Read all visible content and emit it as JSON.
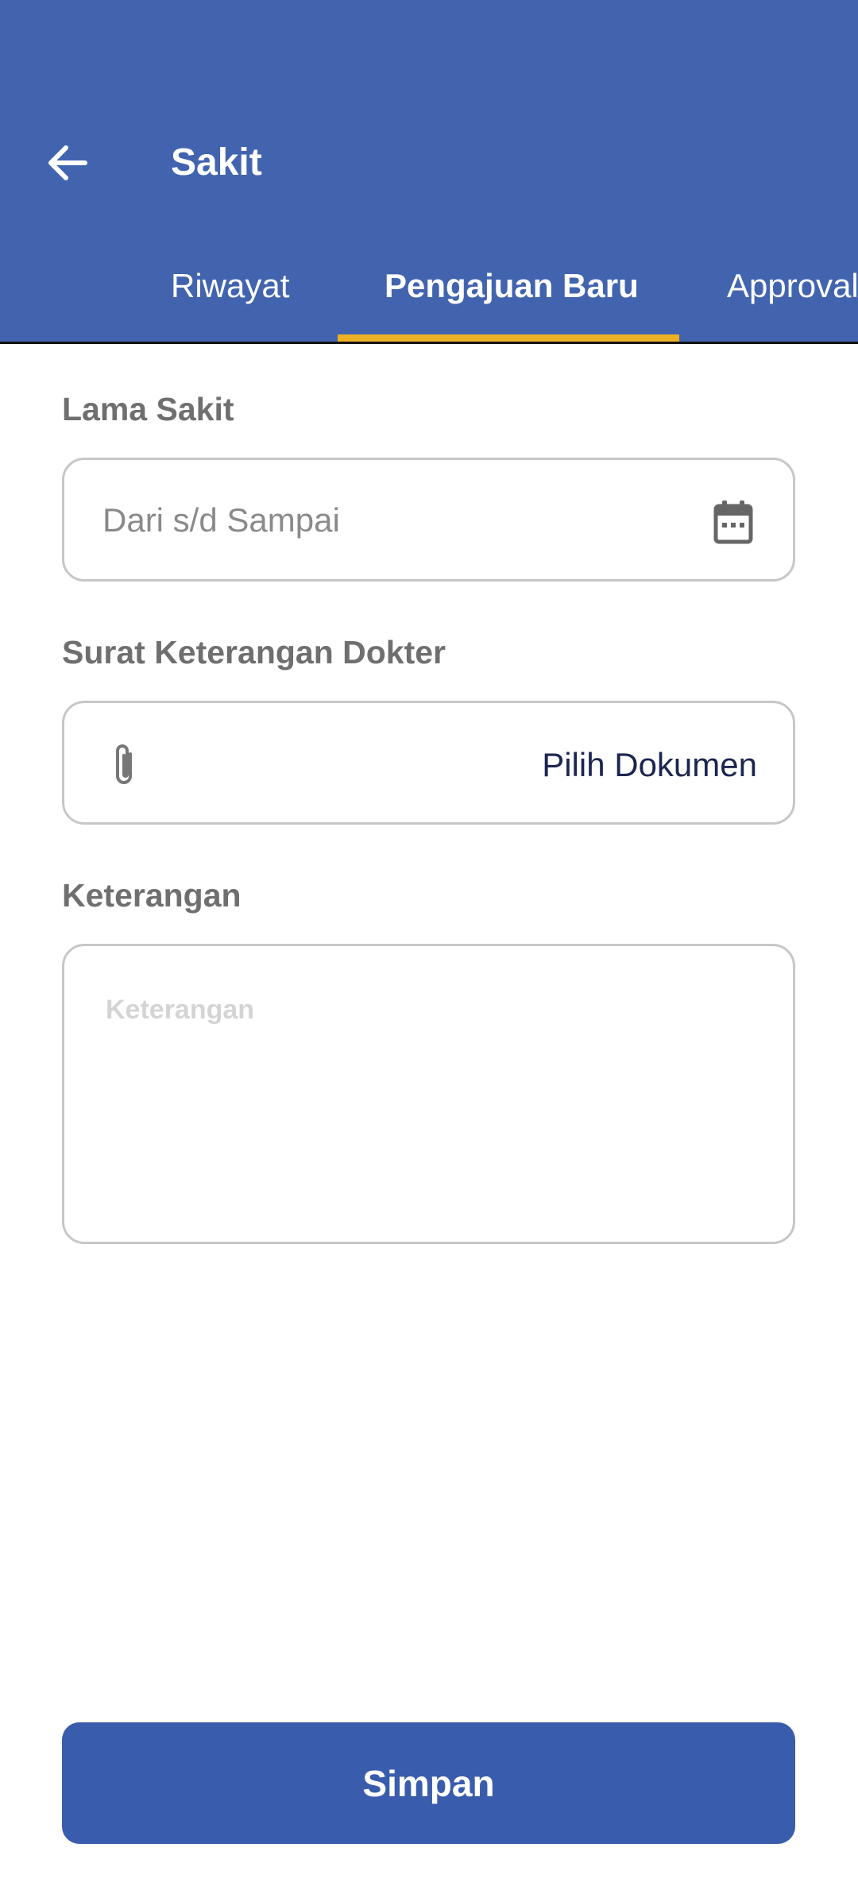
{
  "colors": {
    "appbar": "#4264af",
    "tab_indicator": "#eeb024",
    "primary_button": "#3a5cac",
    "label_text": "#6f6f6f",
    "field_border": "#c7c7c7"
  },
  "appbar": {
    "back_icon": "arrow-left-icon",
    "title": "Sakit"
  },
  "tabs": [
    {
      "label": "Riwayat",
      "active": false
    },
    {
      "label": "Pengajuan Baru",
      "active": true
    },
    {
      "label": "Approval",
      "active": false
    }
  ],
  "form": {
    "lama_sakit": {
      "label": "Lama Sakit",
      "placeholder": "Dari s/d Sampai",
      "icon": "calendar-icon"
    },
    "surat_dokter": {
      "label": "Surat Keterangan Dokter",
      "icon": "paperclip-icon",
      "action": "Pilih Dokumen"
    },
    "keterangan": {
      "label": "Keterangan",
      "placeholder": "Keterangan"
    }
  },
  "save_button": {
    "label": "Simpan"
  }
}
